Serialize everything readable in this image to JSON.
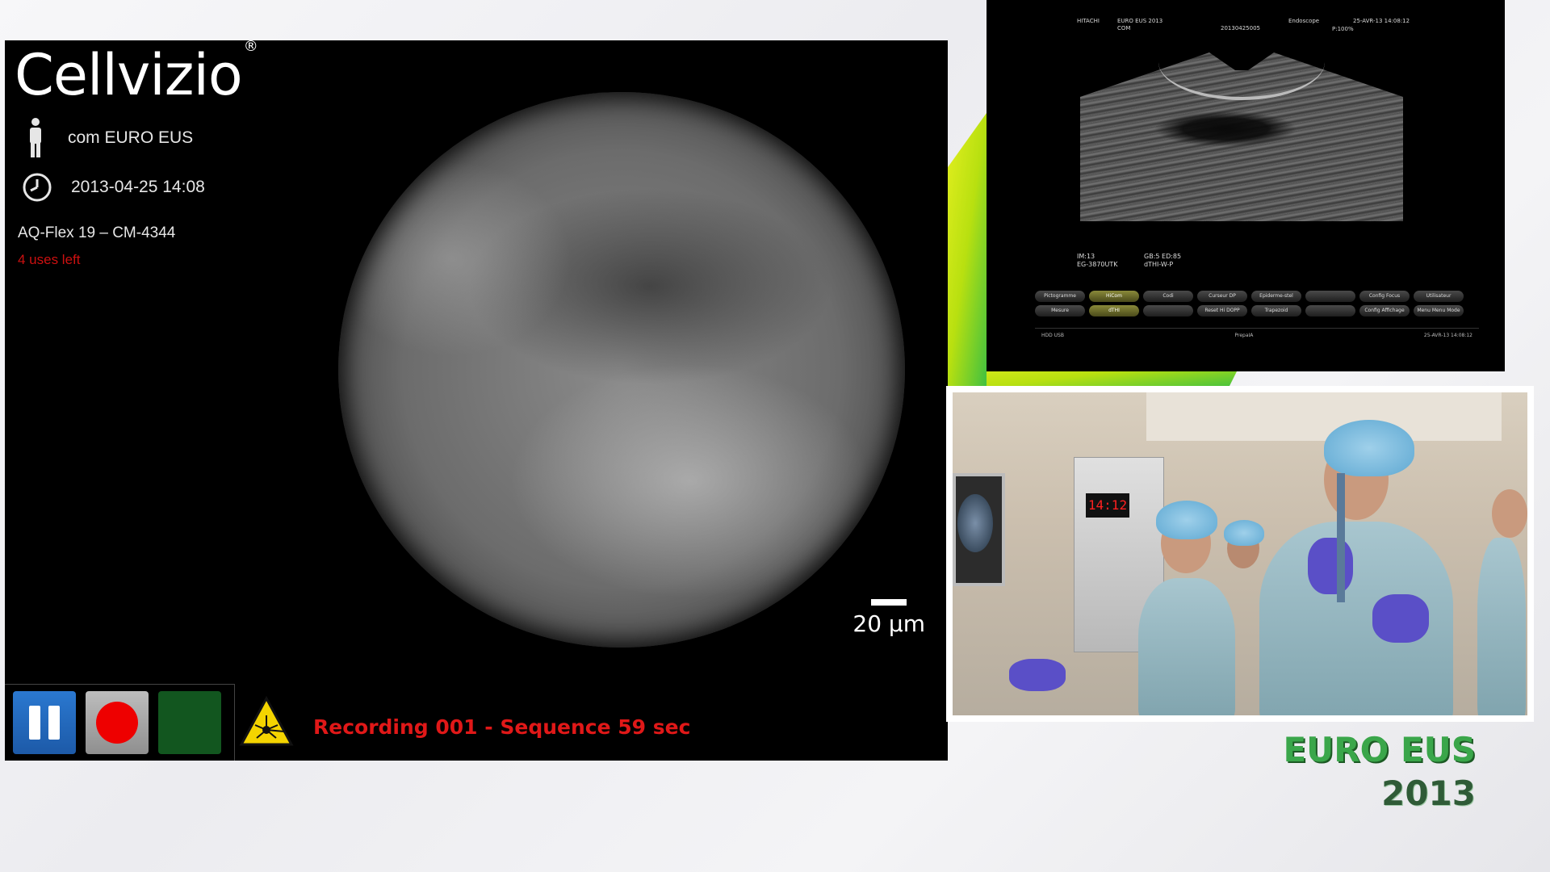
{
  "cellvizio": {
    "brand": "Cellvizio",
    "brand_mark": "®",
    "patient_label": "com EURO EUS",
    "datetime": "2013-04-25 14:08",
    "probe": "AQ-Flex 19 – CM-4344",
    "uses_left": "4 uses left",
    "scale_label": "20 µm",
    "recording_status": "Recording 001 - Sequence 59 sec",
    "icons": [
      "person-icon",
      "clock-icon",
      "pause-icon",
      "record-icon",
      "stop-icon",
      "laser-warning-icon"
    ]
  },
  "ultrasound": {
    "header_brand": "HITACHI",
    "header_name": "EURO EUS 2013",
    "header_sub": "COM",
    "header_id": "20130425005",
    "header_mode": "Endoscope",
    "header_date": "25-AVR-13 14:08:12",
    "header_power": "P:100%",
    "meta_left": [
      "IM:13",
      "EG-3870UTK"
    ],
    "meta_right": [
      "GB:5  ED:85",
      "dTHI-W-P"
    ],
    "buttons": [
      {
        "label": "Pictogramme",
        "active": false
      },
      {
        "label": "HiCom",
        "active": true
      },
      {
        "label": "Codi",
        "active": false
      },
      {
        "label": "Curseur DP",
        "active": false
      },
      {
        "label": "Epiderme-stel",
        "active": false
      },
      {
        "label": "",
        "active": false
      },
      {
        "label": "Config Focus",
        "active": false
      },
      {
        "label": "Utilisateur",
        "active": false
      },
      {
        "label": "Mesure",
        "active": false
      },
      {
        "label": "dTHI",
        "active": true
      },
      {
        "label": "",
        "active": false
      },
      {
        "label": "Reset Hi DOPP",
        "active": false
      },
      {
        "label": "Trapezoid",
        "active": false
      },
      {
        "label": "",
        "active": false
      },
      {
        "label": "Config Affichage",
        "active": false
      },
      {
        "label": "Menu Menu Mode",
        "active": false
      }
    ],
    "status_left": "HDD  USB",
    "status_mid": "PrepaIA",
    "status_right": "25-AVR-13 14:08:12"
  },
  "room": {
    "clock_display": "14:12"
  },
  "logo": {
    "line1": "EURO EUS",
    "line2": "2013"
  },
  "colors": {
    "recording_red": "#e01818",
    "uses_red": "#cc1010",
    "pause_blue": "#2a78d0",
    "stop_green": "#12561f",
    "logo_green": "#3aa64a",
    "accent_yellow_green": "#c8e614"
  }
}
